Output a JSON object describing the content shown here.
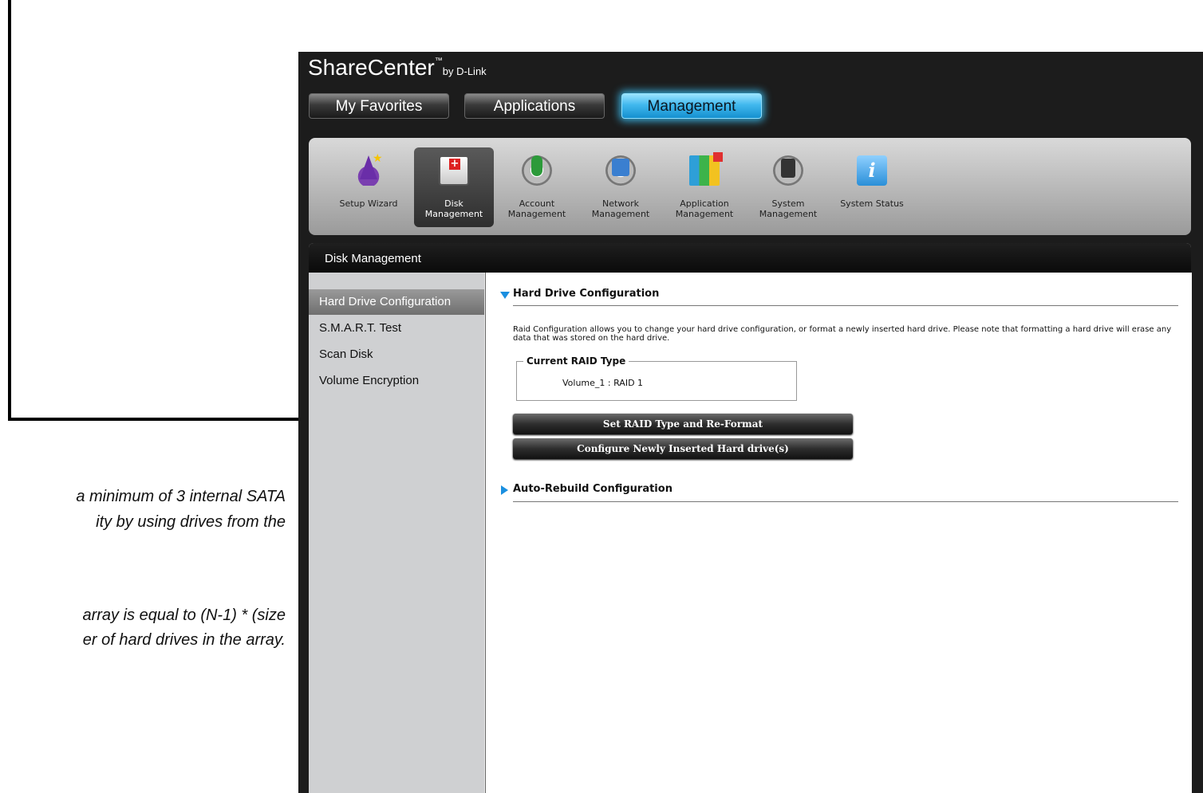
{
  "annotation": {
    "lines": [
      "a minimum of 3 internal SATA",
      "ity by using drives from the",
      "",
      "array is equal to (N-1) * (size",
      "er of hard drives in the array."
    ]
  },
  "app": {
    "brand": "ShareCenter",
    "brand_tm": "™",
    "brand_by": "by D-Link",
    "tabs": [
      {
        "label": "My Favorites"
      },
      {
        "label": "Applications"
      },
      {
        "label": "Management"
      }
    ],
    "toolbar": [
      {
        "label": "Setup Wizard",
        "icon": "wizard-icon"
      },
      {
        "label": "Disk\nManagement",
        "icon": "disk-icon"
      },
      {
        "label": "Account\nManagement",
        "icon": "account-icon"
      },
      {
        "label": "Network\nManagement",
        "icon": "network-icon"
      },
      {
        "label": "Application\nManagement",
        "icon": "application-icon"
      },
      {
        "label": "System\nManagement",
        "icon": "system-icon"
      },
      {
        "label": "System Status",
        "icon": "info-icon"
      }
    ]
  },
  "panel": {
    "title": "Disk Management",
    "sidebar": [
      {
        "label": "Hard Drive Configuration"
      },
      {
        "label": "S.M.A.R.T. Test"
      },
      {
        "label": "Scan Disk"
      },
      {
        "label": "Volume Encryption"
      }
    ],
    "section1": {
      "title": "Hard Drive Configuration",
      "description": "Raid Configuration allows you to change your hard drive configuration, or format a newly inserted hard drive. Please note that formatting a hard drive will erase any data that was stored on the hard drive.",
      "fieldset_legend": "Current RAID Type",
      "raid_value": "Volume_1 : RAID 1"
    },
    "buttons": {
      "set_raid": "Set RAID Type and Re-Format",
      "configure_new": "Configure Newly Inserted Hard drive(s)"
    },
    "section2": {
      "title": "Auto-Rebuild Configuration"
    }
  },
  "colors": {
    "accent": "#1a8fe0",
    "active_tab": "#41b8ee",
    "header_bg": "#0a0a0a"
  }
}
